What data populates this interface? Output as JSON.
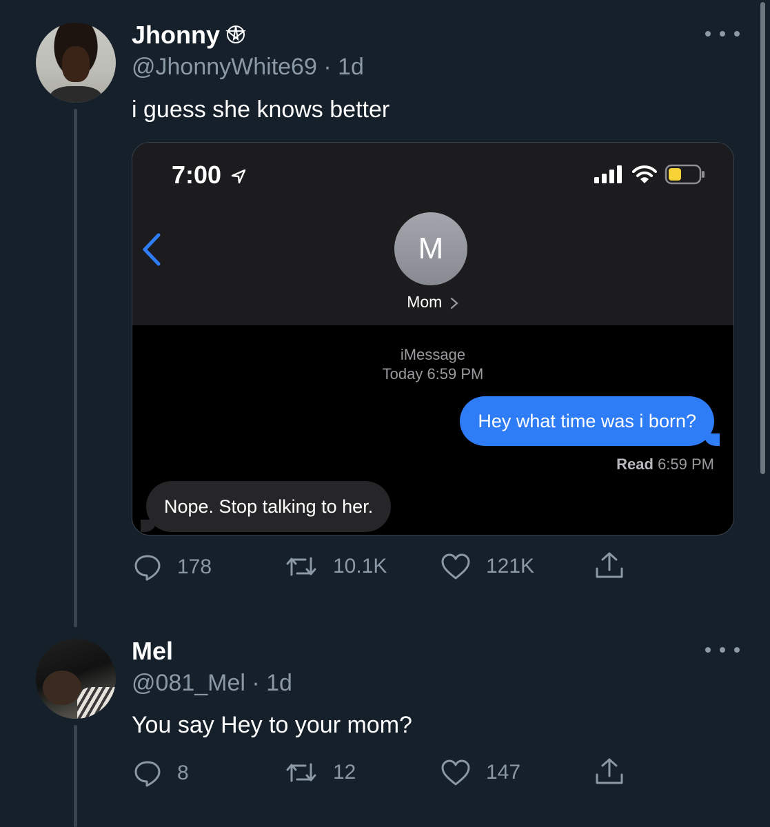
{
  "tweet1": {
    "name": "Jhonny",
    "handle_line": "@JhonnyWhite69 · 1d",
    "text": "i guess she knows better",
    "badge_icon": "pentagram-icon",
    "media": {
      "status_time": "7:00",
      "contact_initial": "M",
      "contact_name": "Mom",
      "service_label": "iMessage",
      "timestamp": "Today 6:59 PM",
      "outgoing_message": "Hey what time was i born?",
      "read_label": "Read",
      "read_time": "6:59 PM",
      "incoming_message": "Nope. Stop talking to her."
    },
    "actions": {
      "replies": "178",
      "retweets": "10.1K",
      "likes": "121K"
    }
  },
  "tweet2": {
    "name": "Mel",
    "handle_line": "@081_Mel · 1d",
    "text": "You say Hey to your mom?",
    "actions": {
      "replies": "8",
      "retweets": "12",
      "likes": "147"
    }
  },
  "colors": {
    "background": "#15202b",
    "secondary_text": "#8b98a5",
    "imessage_blue": "#2f7df6"
  }
}
